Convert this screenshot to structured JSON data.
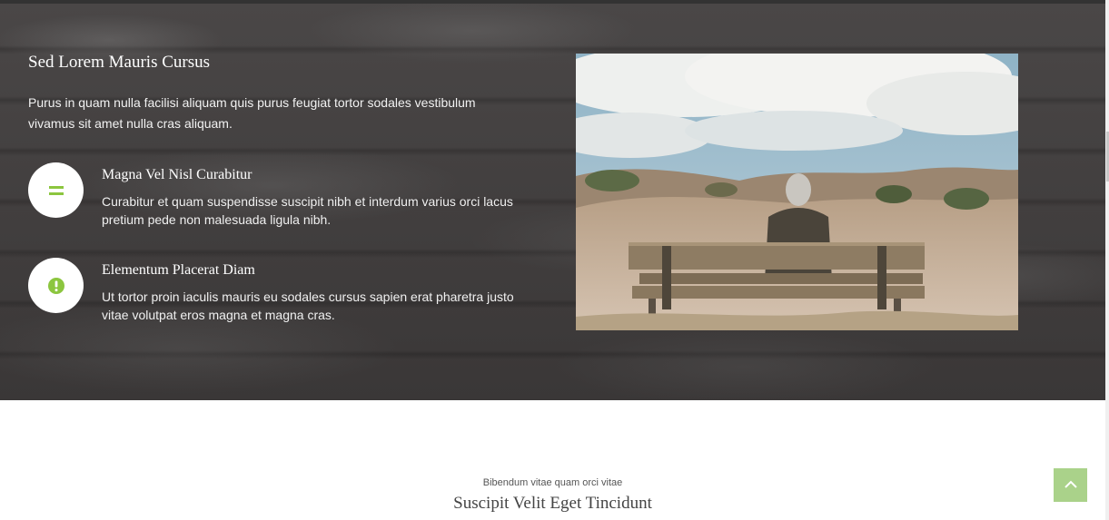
{
  "hero": {
    "title": "Sed Lorem Mauris Cursus",
    "intro": "Purus in quam nulla facilisi aliquam quis purus feugiat tortor sodales vestibulum vivamus sit amet nulla cras aliquam.",
    "features": [
      {
        "icon": "equals-icon",
        "title": "Magna Vel Nisl Curabitur",
        "text": "Curabitur et quam suspendisse suscipit nibh et interdum varius orci lacus pretium pede non malesuada ligula nibh."
      },
      {
        "icon": "exclamation-circle-icon",
        "title": "Elementum Placerat Diam",
        "text": "Ut tortor proin iaculis mauris eu sodales cursus sapien erat pharetra justo vitae volutpat eros magna et magna cras."
      }
    ],
    "photo_description_icon": "person-on-bench-image"
  },
  "section2": {
    "subtitle": "Bibendum vitae quam orci vitae",
    "title": "Suscipit Velit Eget Tincidunt"
  },
  "scroll_top": {
    "icon": "chevron-up-icon"
  },
  "colors": {
    "accent": "#8cc63f",
    "to_top_bg": "#aad28a",
    "hero_bg": "#444141"
  }
}
